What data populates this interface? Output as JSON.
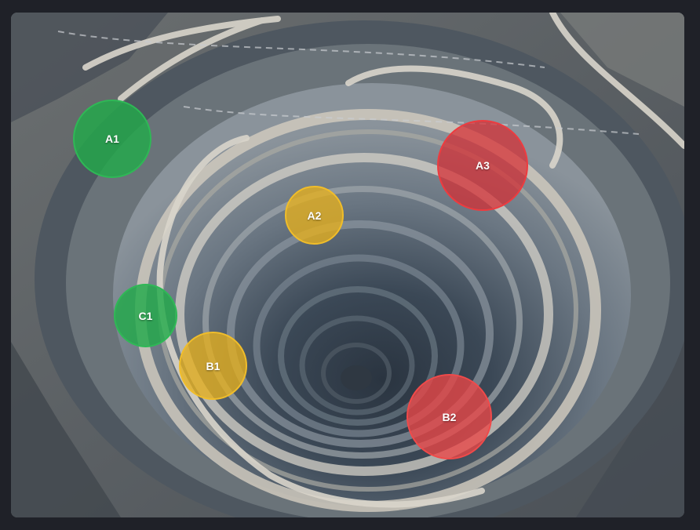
{
  "markers": [
    {
      "id": "A1",
      "label": "A1",
      "color": "#22aa4a"
    },
    {
      "id": "A2",
      "label": "A2",
      "color": "#e6af1e"
    },
    {
      "id": "A3",
      "label": "A3",
      "color": "#d72d32"
    },
    {
      "id": "C1",
      "label": "C1",
      "color": "#22aa4a"
    },
    {
      "id": "B1",
      "label": "B1",
      "color": "#e6af1e"
    },
    {
      "id": "B2",
      "label": "B2",
      "color": "#eb4646"
    }
  ],
  "image": {
    "subject": "aerial-open-pit-mine"
  }
}
